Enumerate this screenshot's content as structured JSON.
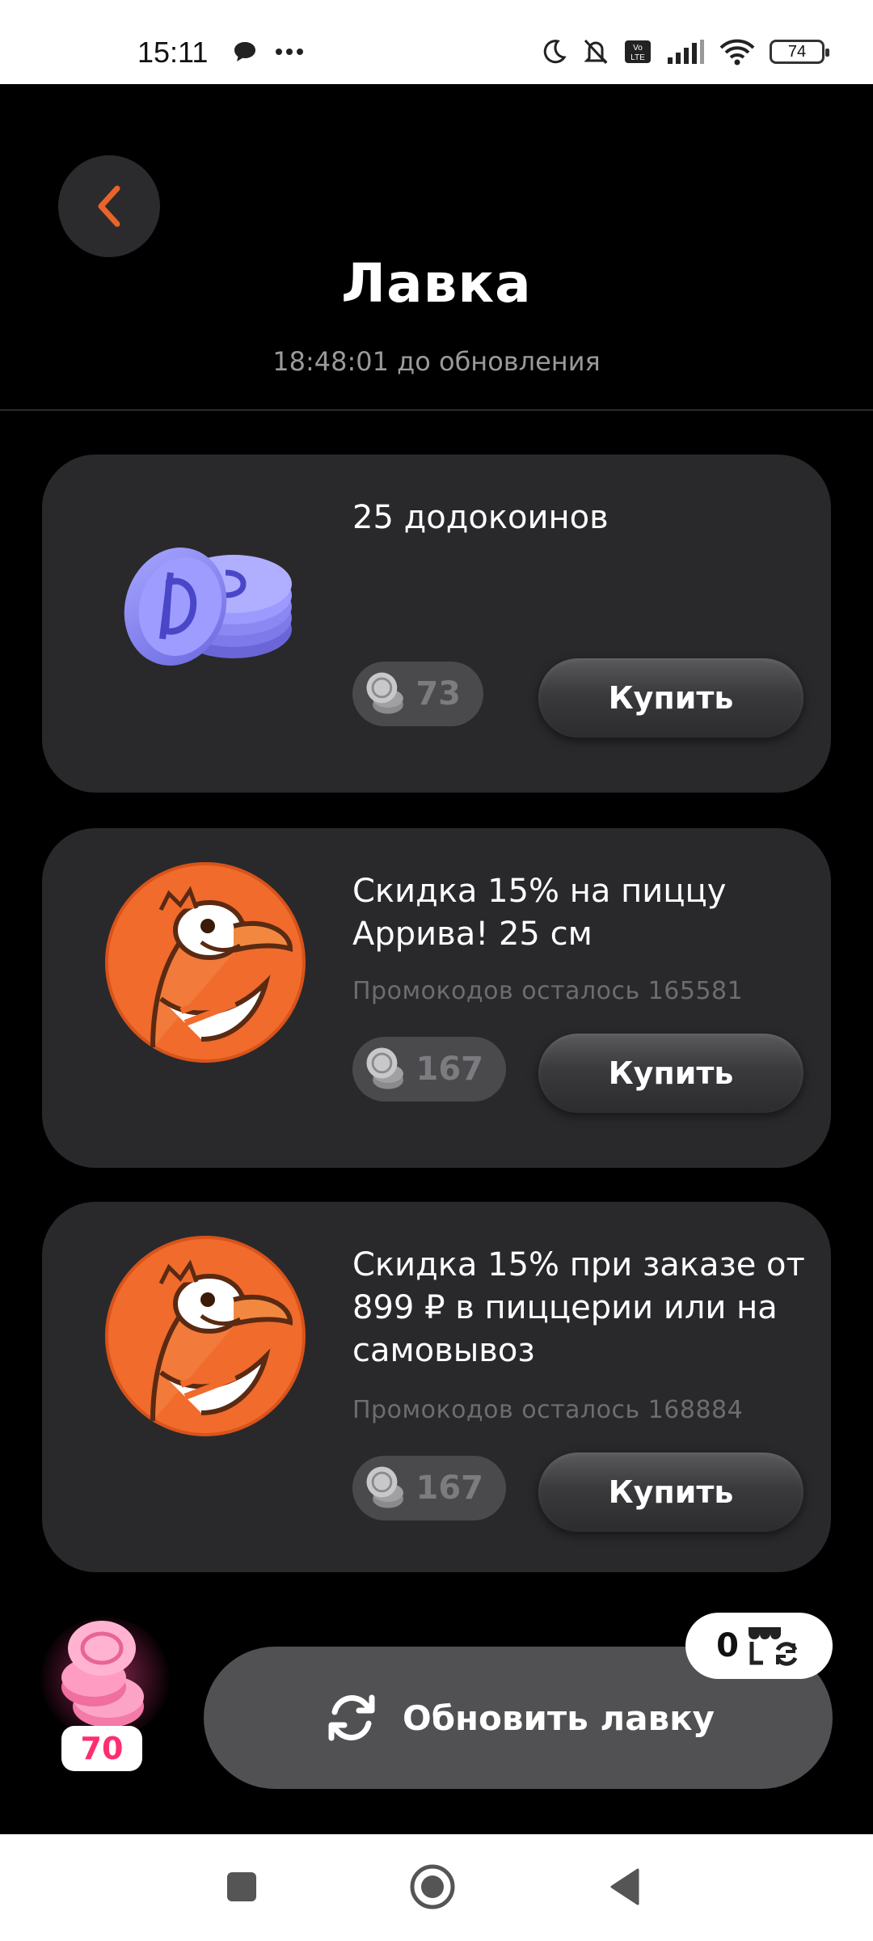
{
  "status_bar": {
    "time": "15:11",
    "battery": "74"
  },
  "header": {
    "title": "Лавка",
    "subtitle": "18:48:01 до обновления"
  },
  "items": [
    {
      "title": "25 додокоинов",
      "meta": "",
      "price": "73",
      "buy_label": "Купить",
      "image": "dodocoins-stack-icon"
    },
    {
      "title": "Скидка 15% на пиццу Аррива! 25 см",
      "meta": "Промокодов осталось 165581",
      "price": "167",
      "buy_label": "Купить",
      "image": "dodo-bird-logo"
    },
    {
      "title": "Скидка 15% при заказе от 899 ₽ в пиццерии или на самовывоз",
      "meta": "Промокодов осталось 168884",
      "price": "167",
      "buy_label": "Купить",
      "image": "dodo-bird-logo"
    }
  ],
  "balance": {
    "value": "70"
  },
  "refresh": {
    "label": "Обновить лавку",
    "counter": "0"
  },
  "colors": {
    "background": "#000000",
    "card": "#29292c",
    "accent_orange": "#e8642a",
    "balance_pink": "#ff2d6f"
  }
}
